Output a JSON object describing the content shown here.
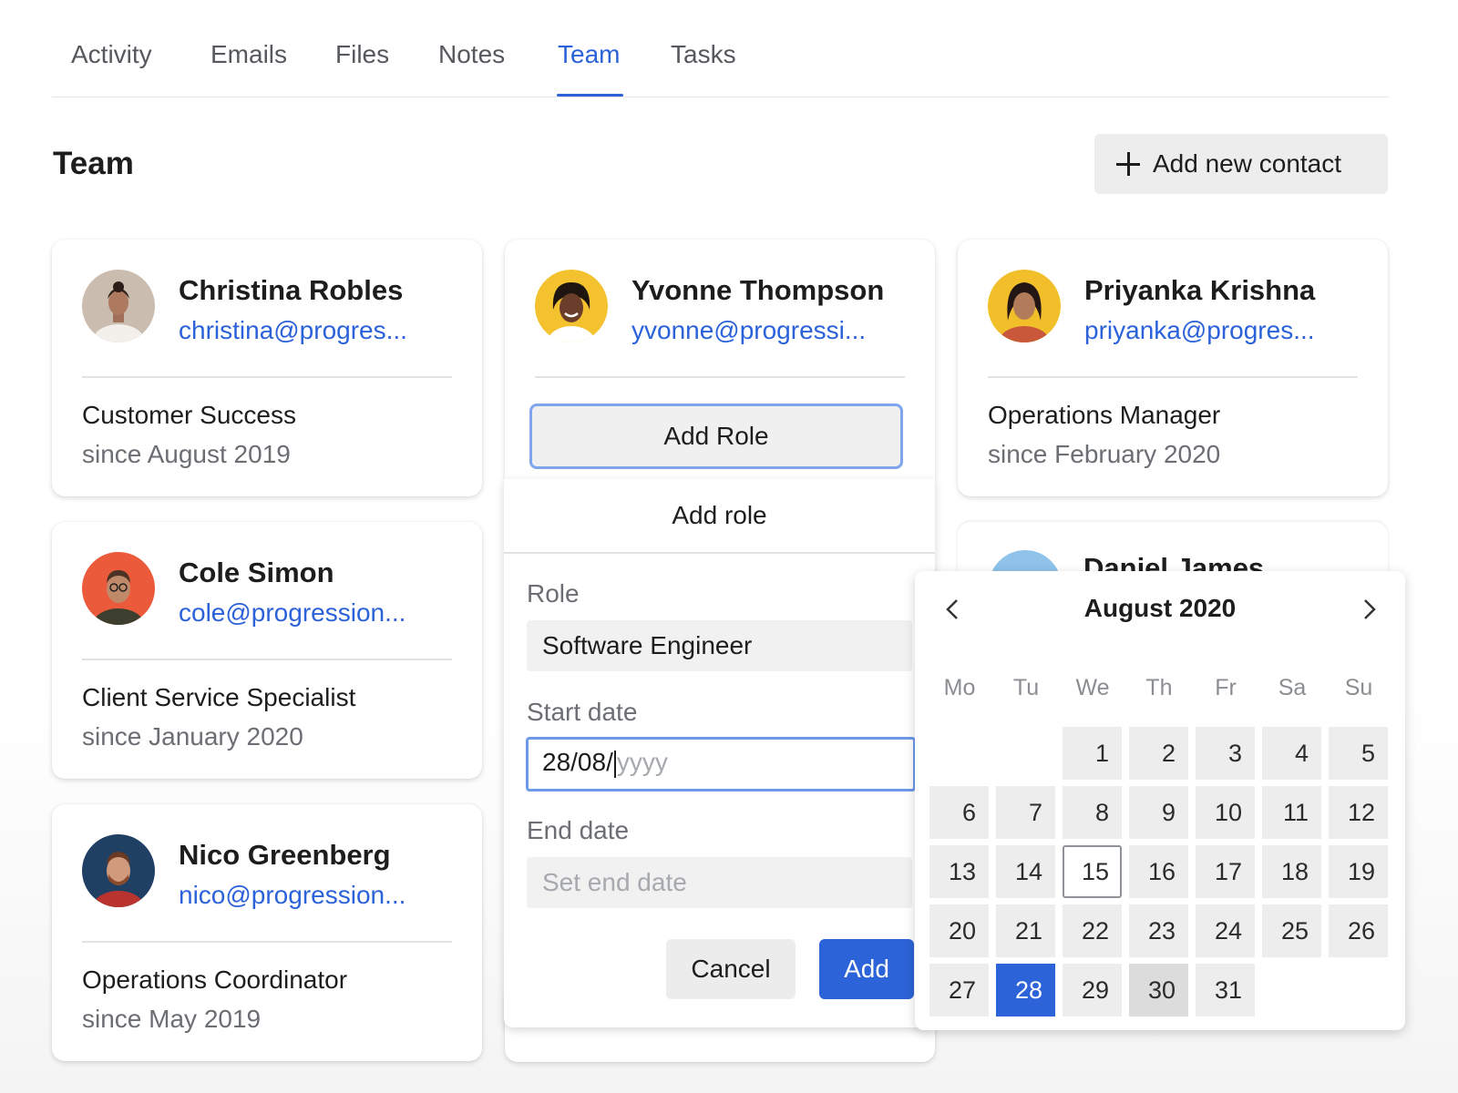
{
  "tabs": [
    {
      "label": "Activity",
      "active": false
    },
    {
      "label": "Emails",
      "active": false
    },
    {
      "label": "Files",
      "active": false
    },
    {
      "label": "Notes",
      "active": false
    },
    {
      "label": "Team",
      "active": true
    },
    {
      "label": "Tasks",
      "active": false
    }
  ],
  "page_title": "Team",
  "add_contact_label": "Add new contact",
  "contacts": [
    {
      "name": "Christina Robles",
      "email": "christina@progres...",
      "role": "Customer Success",
      "since": "since August 2019"
    },
    {
      "name": "Yvonne Thompson",
      "email": "yvonne@progressi...",
      "add_role_label": "Add Role"
    },
    {
      "name": "Priyanka Krishna",
      "email": "priyanka@progres...",
      "role": "Operations Manager",
      "since": "since February 2020"
    },
    {
      "name": "Cole Simon",
      "email": "cole@progression...",
      "role": "Client Service Specialist",
      "since": "since January 2020"
    },
    {
      "name": "Daniel James"
    },
    {
      "name": "Nico Greenberg",
      "email": "nico@progression...",
      "role": "Operations Coordinator",
      "since": "since May 2019"
    }
  ],
  "add_role_popup": {
    "title": "Add role",
    "role_label": "Role",
    "role_value": "Software Engineer",
    "start_label": "Start date",
    "start_value": "28/08/",
    "start_placeholder": "yyyy",
    "end_label": "End date",
    "end_placeholder": "Set end date",
    "cancel_label": "Cancel",
    "add_label": "Add"
  },
  "calendar": {
    "title": "August 2020",
    "prev_icon": "chevron-left-icon",
    "next_icon": "chevron-right-icon",
    "weekdays": [
      "Mo",
      "Tu",
      "We",
      "Th",
      "Fr",
      "Sa",
      "Su"
    ],
    "first_weekday_index": 2,
    "days": [
      "1",
      "2",
      "3",
      "4",
      "5",
      "6",
      "7",
      "8",
      "9",
      "10",
      "11",
      "12",
      "13",
      "14",
      "15",
      "16",
      "17",
      "18",
      "19",
      "20",
      "21",
      "22",
      "23",
      "24",
      "25",
      "26",
      "27",
      "28",
      "29",
      "30",
      "31"
    ],
    "today": "15",
    "selected": "28",
    "hovered": "30"
  },
  "colors": {
    "accent": "#2b62d9",
    "focus_border": "#6c9ae8"
  }
}
